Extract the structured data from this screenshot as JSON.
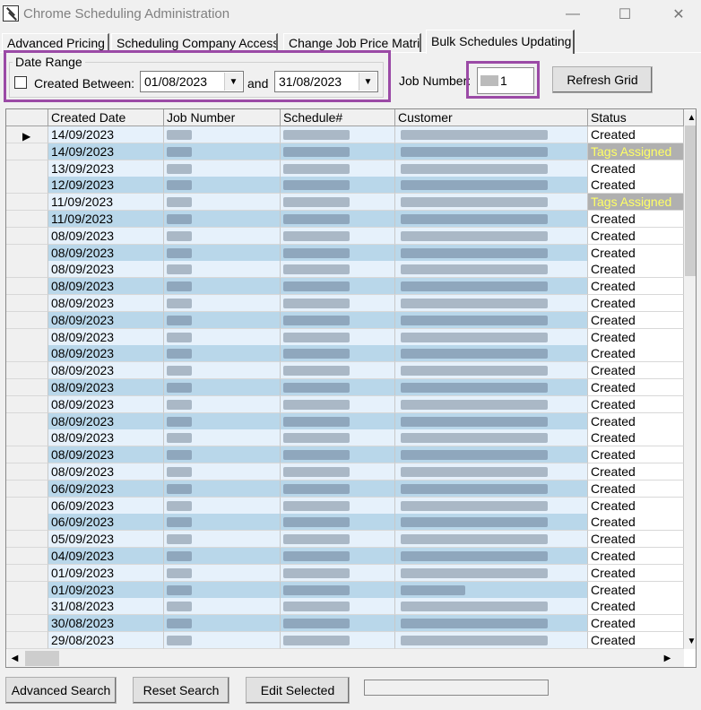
{
  "window": {
    "title": "Chrome Scheduling Administration",
    "minimize": "—",
    "maximize": "☐",
    "close": "✕"
  },
  "tabs": [
    {
      "label": "Advanced Pricing",
      "active": false
    },
    {
      "label": "Scheduling Company Access",
      "active": false
    },
    {
      "label": "Change Job Price Matrix",
      "active": false
    },
    {
      "label": "Bulk Schedules Updating",
      "active": true
    }
  ],
  "filter": {
    "group_label": "Date Range",
    "created_between_label": "Created Between:",
    "created_between_checked": false,
    "date_from": "01/08/2023",
    "and_label": "and",
    "date_to": "31/08/2023",
    "job_number_label": "Job Number:",
    "job_number_suffix": "1",
    "refresh_label": "Refresh Grid"
  },
  "grid": {
    "columns": [
      "Created Date",
      "Job Number",
      "Schedule#",
      "Customer",
      "Status"
    ],
    "rows": [
      {
        "date": "14/09/2023",
        "status": "Created"
      },
      {
        "date": "14/09/2023",
        "status": "Tags Assigned"
      },
      {
        "date": "13/09/2023",
        "status": "Created"
      },
      {
        "date": "12/09/2023",
        "status": "Created"
      },
      {
        "date": "11/09/2023",
        "status": "Tags Assigned"
      },
      {
        "date": "11/09/2023",
        "status": "Created"
      },
      {
        "date": "08/09/2023",
        "status": "Created"
      },
      {
        "date": "08/09/2023",
        "status": "Created"
      },
      {
        "date": "08/09/2023",
        "status": "Created"
      },
      {
        "date": "08/09/2023",
        "status": "Created"
      },
      {
        "date": "08/09/2023",
        "status": "Created"
      },
      {
        "date": "08/09/2023",
        "status": "Created"
      },
      {
        "date": "08/09/2023",
        "status": "Created"
      },
      {
        "date": "08/09/2023",
        "status": "Created"
      },
      {
        "date": "08/09/2023",
        "status": "Created"
      },
      {
        "date": "08/09/2023",
        "status": "Created"
      },
      {
        "date": "08/09/2023",
        "status": "Created"
      },
      {
        "date": "08/09/2023",
        "status": "Created"
      },
      {
        "date": "08/09/2023",
        "status": "Created"
      },
      {
        "date": "08/09/2023",
        "status": "Created"
      },
      {
        "date": "08/09/2023",
        "status": "Created"
      },
      {
        "date": "06/09/2023",
        "status": "Created"
      },
      {
        "date": "06/09/2023",
        "status": "Created"
      },
      {
        "date": "06/09/2023",
        "status": "Created"
      },
      {
        "date": "05/09/2023",
        "status": "Created"
      },
      {
        "date": "04/09/2023",
        "status": "Created"
      },
      {
        "date": "01/09/2023",
        "status": "Created"
      },
      {
        "date": "01/09/2023",
        "status": "Created"
      },
      {
        "date": "31/08/2023",
        "status": "Created"
      },
      {
        "date": "30/08/2023",
        "status": "Created"
      },
      {
        "date": "29/08/2023",
        "status": "Created"
      }
    ],
    "row_indicator": "▶",
    "scroll_up": "▲",
    "scroll_down": "▼",
    "scroll_left": "◀",
    "scroll_right": "▶"
  },
  "footer": {
    "advanced_search": "Advanced Search",
    "reset_search": "Reset Search",
    "edit_selected": "Edit Selected"
  },
  "colors": {
    "highlight": "#9b4aa6",
    "row_a": "#e6f1fb",
    "row_b": "#b9d7ea",
    "tags_assigned_bg": "#b0b0b0",
    "tags_assigned_fg": "#ffff66"
  }
}
